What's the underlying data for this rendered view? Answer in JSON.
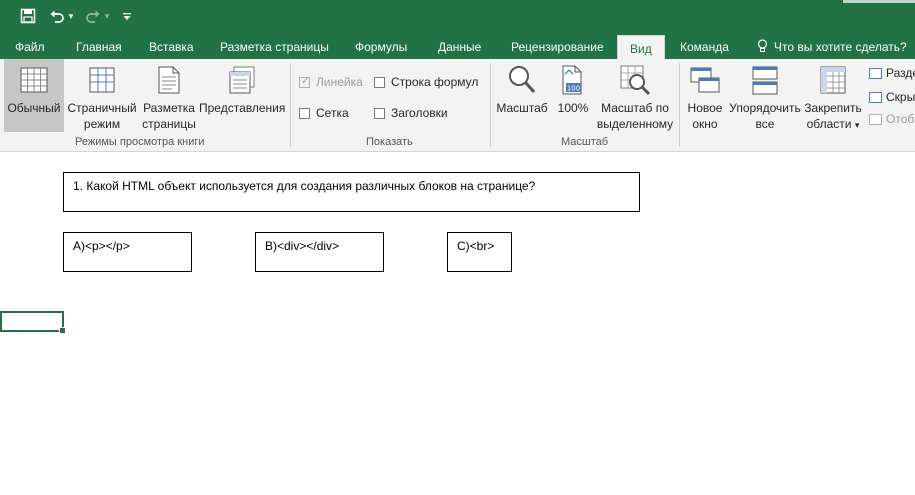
{
  "tabs": [
    {
      "label": "Файл",
      "active": false
    },
    {
      "label": "Главная",
      "active": false
    },
    {
      "label": "Вставка",
      "active": false
    },
    {
      "label": "Разметка страницы",
      "active": false
    },
    {
      "label": "Формулы",
      "active": false
    },
    {
      "label": "Данные",
      "active": false
    },
    {
      "label": "Рецензирование",
      "active": false
    },
    {
      "label": "Вид",
      "active": true
    },
    {
      "label": "Команда",
      "active": false
    }
  ],
  "tell_me": "Что вы хотите сделать?",
  "ribbon": {
    "views_group": {
      "label": "Режимы просмотра книги",
      "buttons": [
        {
          "label": "Обычный",
          "selected": true
        },
        {
          "label": "Страничный режим",
          "selected": false
        },
        {
          "label": "Разметка страницы",
          "selected": false
        },
        {
          "label": "Представления",
          "selected": false
        }
      ]
    },
    "show_group": {
      "label": "Показать",
      "checkboxes": [
        {
          "label": "Линейка",
          "checked": true,
          "disabled": true
        },
        {
          "label": "Строка формул",
          "checked": false,
          "disabled": false
        },
        {
          "label": "Сетка",
          "checked": false,
          "disabled": false
        },
        {
          "label": "Заголовки",
          "checked": false,
          "disabled": false
        }
      ]
    },
    "zoom_group": {
      "label": "Масштаб",
      "buttons": [
        {
          "label": "Масштаб"
        },
        {
          "label": "100%"
        },
        {
          "label": "Масштаб по выделенному"
        }
      ]
    },
    "window_group": {
      "buttons": [
        {
          "label": "Новое окно"
        },
        {
          "label": "Упорядочить все"
        },
        {
          "label": "Закрепить области",
          "dropdown": "▾"
        }
      ],
      "small_items": [
        {
          "label": "Разде",
          "disabled": false
        },
        {
          "label": "Скры",
          "disabled": false
        },
        {
          "label": "Отоб",
          "disabled": true
        }
      ]
    }
  },
  "sheet": {
    "question": "1. Какой HTML объект используется для создания различных блоков на странице?",
    "answers": [
      "A)<p></p>",
      "B)<div></div>",
      "C)<br>"
    ]
  },
  "colors": {
    "accent": "#217346",
    "ribbon_bg": "#f3f3f3",
    "selected_bg": "#c6c6c6"
  }
}
